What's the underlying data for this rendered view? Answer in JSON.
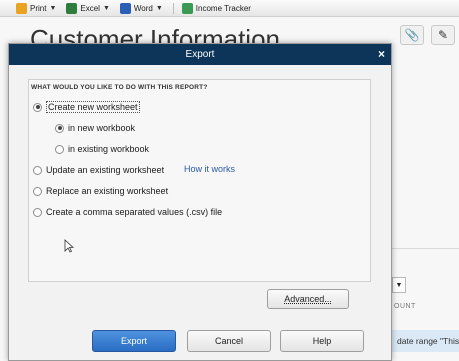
{
  "toolbar": {
    "items": [
      {
        "label": "Print",
        "icon": "printer-icon"
      },
      {
        "label": "Excel",
        "icon": "excel-icon"
      },
      {
        "label": "Word",
        "icon": "word-icon"
      },
      {
        "label": "Income Tracker",
        "icon": "income-tracker-icon"
      }
    ]
  },
  "background": {
    "page_title": "Customer Information",
    "column_fragment": "OUNT",
    "date_fragment": "date range \"This"
  },
  "dialog": {
    "title": "Export",
    "close": "×",
    "group_label": "WHAT WOULD YOU LIKE TO DO WITH THIS REPORT?",
    "options": {
      "new_worksheet": "Create new worksheet",
      "new_workbook": "in new workbook",
      "existing_workbook": "in existing workbook",
      "update_existing": "Update an existing worksheet",
      "replace_existing": "Replace an existing worksheet",
      "csv": "Create a comma separated values (.csv) file"
    },
    "selected": {
      "main": "new_worksheet",
      "sub": "new_workbook"
    },
    "how_it_works": "How it works",
    "buttons": {
      "advanced": "Advanced...",
      "export": "Export",
      "cancel": "Cancel",
      "help": "Help"
    }
  },
  "colors": {
    "titlebar": "#0c3559",
    "primary_button": "#2a6dc4",
    "link": "#2a5aa7"
  }
}
